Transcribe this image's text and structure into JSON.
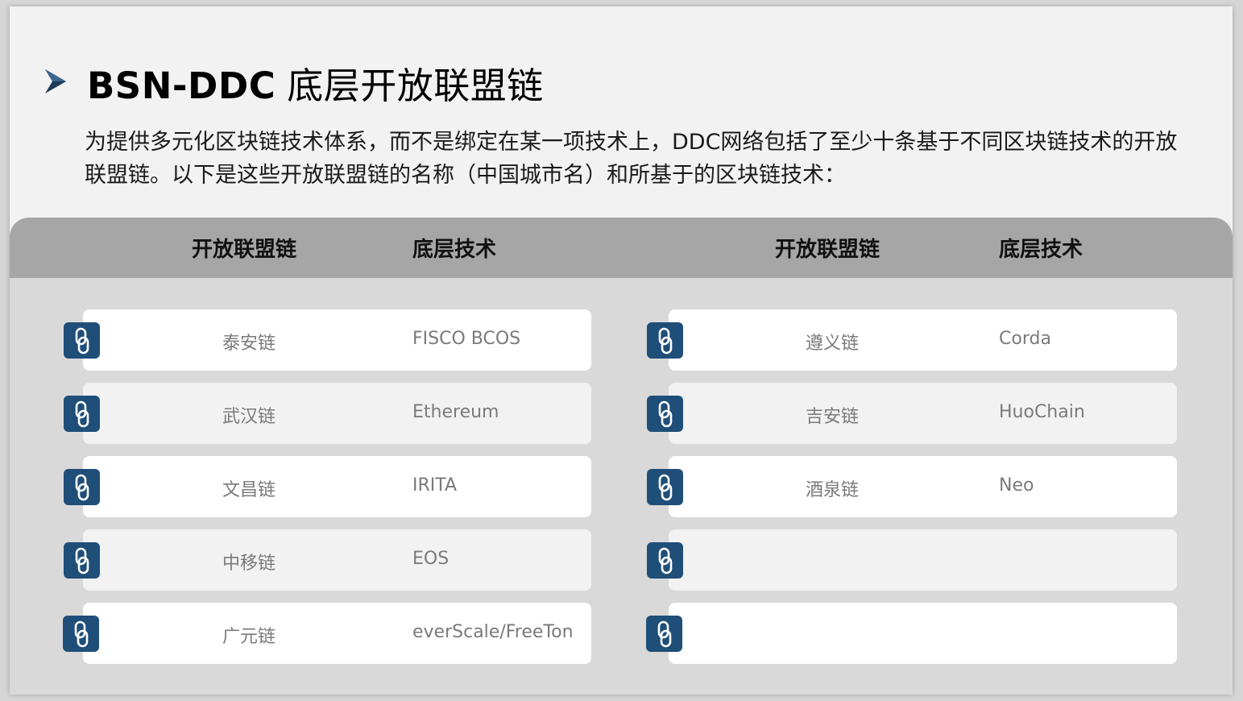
{
  "title": {
    "latin": "BSN-DDC",
    "cjk": "底层开放联盟链"
  },
  "intro": "为提供多元化区块链技术体系，而不是绑定在某一项技术上，DDC网络包括了至少十条基于不同区块链技术的开放联盟链。以下是这些开放联盟链的名称（中国城市名）和所基于的区块链技术：",
  "table": {
    "headers": {
      "left_chain": "开放联盟链",
      "left_tech": "底层技术",
      "right_chain": "开放联盟链",
      "right_tech": "底层技术"
    },
    "left": [
      {
        "chain": "泰安链",
        "tech": "FISCO BCOS"
      },
      {
        "chain": "武汉链",
        "tech": "Ethereum"
      },
      {
        "chain": "文昌链",
        "tech": "IRITA"
      },
      {
        "chain": "中移链",
        "tech": "EOS"
      },
      {
        "chain": "广元链",
        "tech": "everScale/FreeTon"
      }
    ],
    "right": [
      {
        "chain": "遵义链",
        "tech": "Corda"
      },
      {
        "chain": "吉安链",
        "tech": "HuoChain"
      },
      {
        "chain": "酒泉链",
        "tech": "Neo"
      },
      {
        "chain": "",
        "tech": ""
      },
      {
        "chain": "",
        "tech": ""
      }
    ]
  },
  "icons": {
    "bullet": "arrow-bullet-icon",
    "row": "chain-link-icon"
  },
  "colors": {
    "accent": "#1f4e79",
    "header_bg": "#a6a6a6",
    "table_bg": "#d9d9d9",
    "row_white": "#ffffff",
    "row_grey": "#f2f2f2",
    "cell_text": "#7a7a7a"
  }
}
